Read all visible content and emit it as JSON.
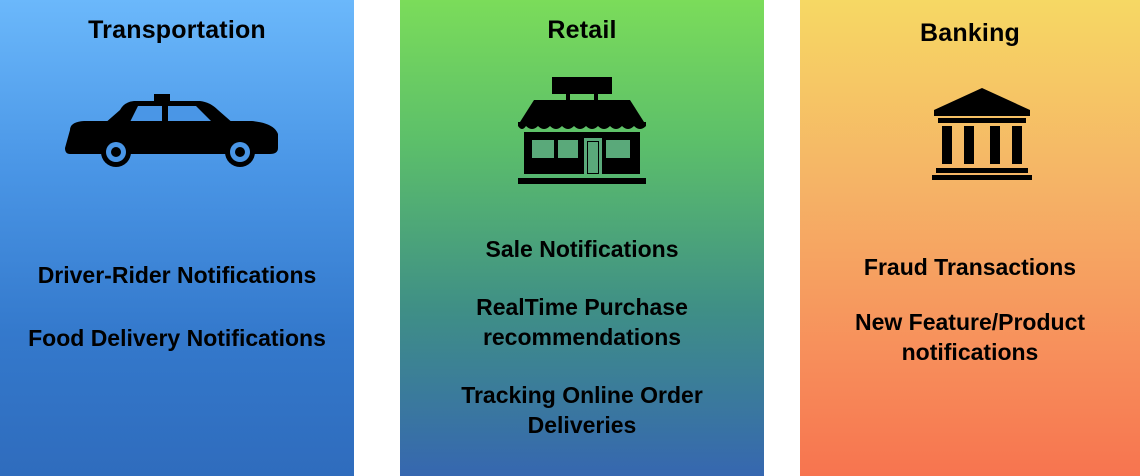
{
  "panels": [
    {
      "title": "Transportation",
      "icon": "taxi-car-icon",
      "items": [
        "Driver-Rider Notifications",
        "Food Delivery Notifications"
      ]
    },
    {
      "title": "Retail",
      "icon": "storefront-icon",
      "items": [
        "Sale Notifications",
        "RealTime Purchase recommendations",
        "Tracking Online Order Deliveries"
      ]
    },
    {
      "title": "Banking",
      "icon": "bank-building-icon",
      "items": [
        "Fraud Transactions",
        "New Feature/Product notifications"
      ]
    }
  ],
  "colors": {
    "transportation": "#4a96e6",
    "retail": "#5cbf6a",
    "banking": "#f5a963"
  }
}
